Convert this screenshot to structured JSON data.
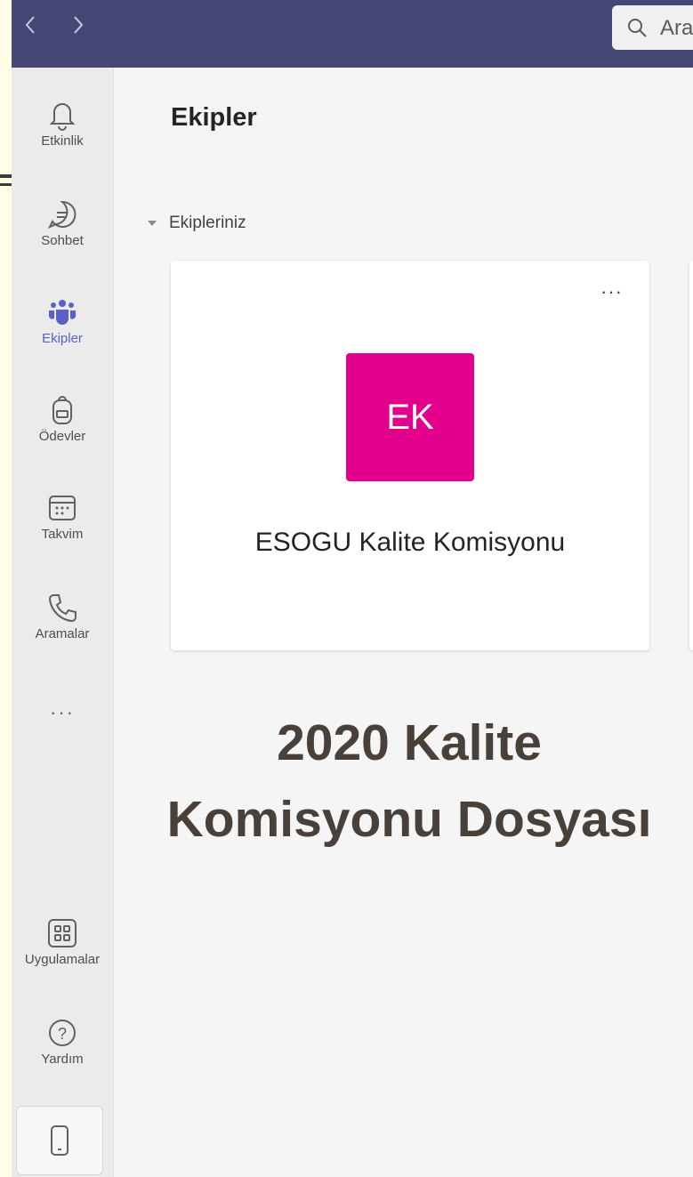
{
  "search": {
    "text": "Ara"
  },
  "sidebar": {
    "items": [
      {
        "label": "Etkinlik",
        "icon": "bell-icon"
      },
      {
        "label": "Sohbet",
        "icon": "chat-icon"
      },
      {
        "label": "Ekipler",
        "icon": "teams-icon",
        "active": true
      },
      {
        "label": "Ödevler",
        "icon": "backpack-icon"
      },
      {
        "label": "Takvim",
        "icon": "calendar-icon"
      },
      {
        "label": "Aramalar",
        "icon": "phone-icon"
      },
      {
        "label": "Uygulamalar",
        "icon": "apps-icon"
      },
      {
        "label": "Yardım",
        "icon": "help-icon"
      }
    ],
    "more": "···"
  },
  "main": {
    "title": "Ekipler",
    "section": "Ekipleriniz",
    "card": {
      "more": "···",
      "avatar": "EK",
      "avatar_color": "#e3008c",
      "name": "ESOGU Kalite Komisyonu"
    }
  },
  "headline": {
    "line1": "2020 Kalite",
    "line2": "Komisyonu Dosyası"
  },
  "colors": {
    "topbar": "#464775",
    "accent": "#5b5fc7"
  }
}
